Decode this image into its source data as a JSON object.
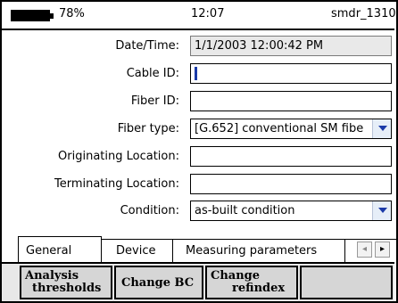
{
  "status": {
    "battery_icon": "battery-icon",
    "battery_pct": "78%",
    "time": "12:07",
    "device": "smdr_1310"
  },
  "form": {
    "datetime": {
      "label": "Date/Time:",
      "value": "1/1/2003 12:00:42 PM"
    },
    "cable_id": {
      "label": "Cable ID:",
      "value": ""
    },
    "fiber_id": {
      "label": "Fiber ID:",
      "value": ""
    },
    "fiber_type": {
      "label": "Fiber type:",
      "value": "[G.652] conventional SM fibe"
    },
    "orig_location": {
      "label": "Originating Location:",
      "value": ""
    },
    "term_location": {
      "label": "Terminating Location:",
      "value": ""
    },
    "condition": {
      "label": "Condition:",
      "value": "as-built condition"
    }
  },
  "tabs": {
    "general": "General",
    "device": "Device",
    "measuring": "Measuring parameters",
    "left_arrow": "◂",
    "right_arrow": "▸"
  },
  "buttons": {
    "analysis_1": "Analysis",
    "analysis_2": "thresholds",
    "change_bc": "Change BC",
    "refindex_1": "Change",
    "refindex_2": "refindex"
  }
}
